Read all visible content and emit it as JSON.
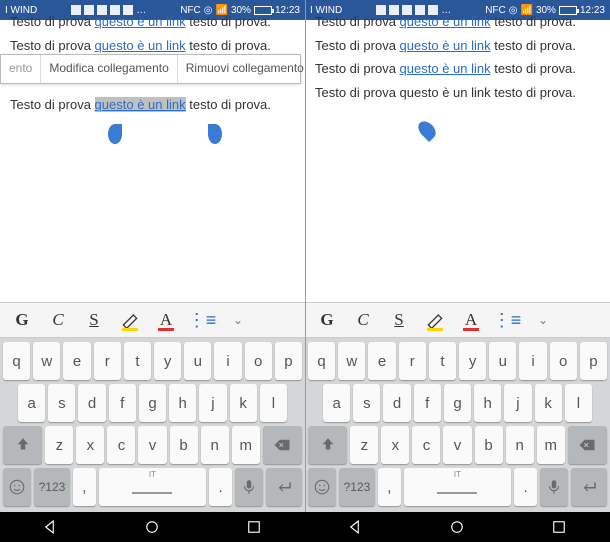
{
  "status": {
    "carrier": "I WIND",
    "battery": "30%",
    "time": "12:23"
  },
  "doc": {
    "plain": "Testo di prova ",
    "link": "questo è un link",
    "tail": " testo di prova."
  },
  "ctx": {
    "cut": "ento",
    "edit": "Modifica collegamento",
    "remove": "Rimuovi collegamento"
  },
  "toolbar": {
    "bold": "G",
    "italic": "C",
    "underline": "S",
    "highlight": "A",
    "fontcolor": "A"
  },
  "kbd": {
    "r1": [
      "q",
      "w",
      "e",
      "r",
      "t",
      "y",
      "u",
      "i",
      "o",
      "p"
    ],
    "r2": [
      "a",
      "s",
      "d",
      "f",
      "g",
      "h",
      "j",
      "k",
      "l"
    ],
    "r3": [
      "z",
      "x",
      "c",
      "v",
      "b",
      "n",
      "m"
    ],
    "sym": "?123",
    "comma": ",",
    "period": ".",
    "lang": "IT"
  }
}
